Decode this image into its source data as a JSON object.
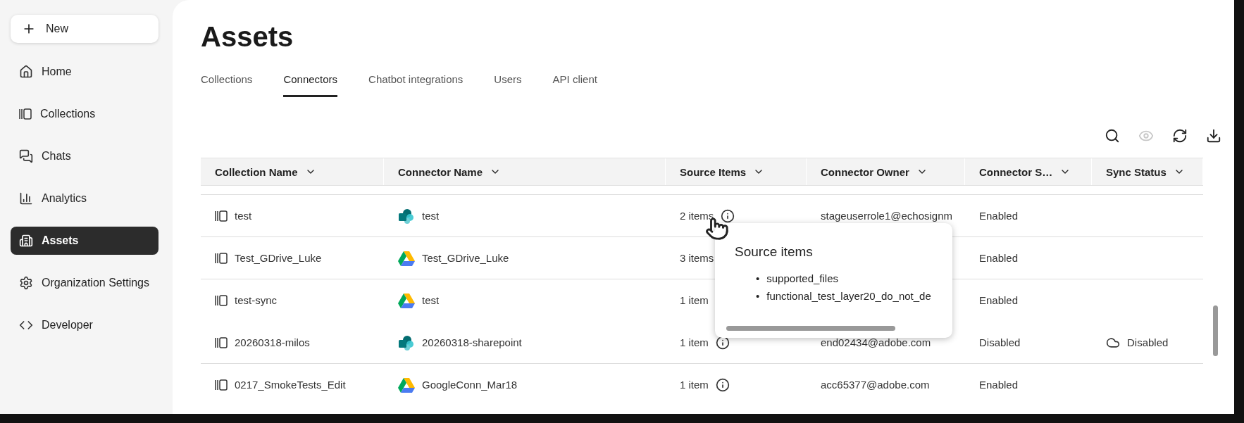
{
  "sidebar": {
    "new_button": "New",
    "items": [
      {
        "kind": "home",
        "label": "Home",
        "selected": false
      },
      {
        "kind": "collections",
        "label": "Collections",
        "selected": false
      },
      {
        "kind": "chats",
        "label": "Chats",
        "selected": false
      },
      {
        "kind": "analytics",
        "label": "Analytics",
        "selected": false
      },
      {
        "kind": "assets",
        "label": "Assets",
        "selected": true
      },
      {
        "kind": "settings",
        "label": "Organization Settings",
        "selected": false
      },
      {
        "kind": "developer",
        "label": "Developer",
        "selected": false
      }
    ]
  },
  "page": {
    "title": "Assets",
    "tabs": [
      {
        "label": "Collections",
        "selected": false
      },
      {
        "label": "Connectors",
        "selected": true
      },
      {
        "label": "Chatbot integrations",
        "selected": false
      },
      {
        "label": "Users",
        "selected": false
      },
      {
        "label": "API client",
        "selected": false
      }
    ]
  },
  "toolbar": [
    {
      "kind": "search",
      "disabled": false
    },
    {
      "kind": "view",
      "disabled": true
    },
    {
      "kind": "refresh",
      "disabled": false
    },
    {
      "kind": "download",
      "disabled": false
    }
  ],
  "table": {
    "columns": [
      "Collection Name",
      "Connector Name",
      "Source Items",
      "Connector Owner",
      "Connector S…",
      "Sync Status"
    ],
    "rows": [
      {
        "collection": "test",
        "connector": "test",
        "kind": "sharepoint",
        "items": "2 items",
        "owner": "stageuserrole1@echosignm",
        "status": "Enabled"
      },
      {
        "collection": "Test_GDrive_Luke",
        "connector": "Test_GDrive_Luke",
        "kind": "gdrive",
        "items": "3 items",
        "status": "Enabled"
      },
      {
        "collection": "test-sync",
        "connector": "test",
        "kind": "gdrive",
        "items": "1 item",
        "status": "Enabled"
      },
      {
        "collection": "20260318-milos",
        "connector": "20260318-sharepoint",
        "kind": "sharepoint",
        "items": "1 item",
        "owner": "end02434@adobe.com",
        "status": "Disabled",
        "sync_status": "Disabled"
      },
      {
        "collection": "0217_SmokeTests_Edit",
        "connector": "GoogleConn_Mar18",
        "kind": "gdrive",
        "items": "1 item",
        "owner": "acc65377@adobe.com",
        "status": "Enabled"
      }
    ]
  },
  "popover": {
    "title": "Source items",
    "bullet": "•",
    "items": [
      "supported_files",
      "functional_test_layer20_do_not_de"
    ]
  }
}
